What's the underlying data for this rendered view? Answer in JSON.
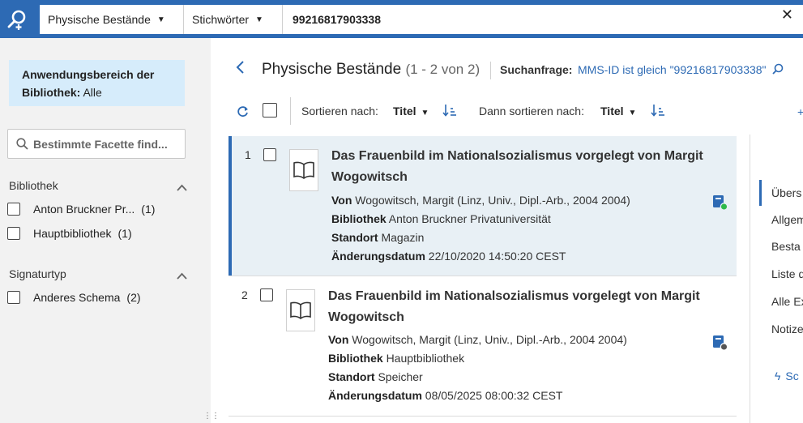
{
  "topbar": {
    "search_scope": "Physische Bestände",
    "search_field": "Stichwörter",
    "search_value": "99216817903338",
    "close_label": "✕"
  },
  "sidebar": {
    "scope_title": "Anwendungsbereich der Bibliothek:",
    "scope_value": "Alle",
    "facet_search_placeholder": "Bestimmte Facette find...",
    "facet_groups": [
      {
        "title": "Bibliothek",
        "items": [
          {
            "label": "Anton Bruckner Pr...",
            "count": "(1)"
          },
          {
            "label": "Hauptbibliothek",
            "count": "(1)"
          }
        ]
      },
      {
        "title": "Signaturtyp",
        "items": [
          {
            "label": "Anderes Schema",
            "count": "(2)"
          }
        ]
      }
    ]
  },
  "header": {
    "title": "Physische Bestände",
    "count": "(1 - 2 von 2)",
    "query_label": "Suchanfrage:",
    "query_value": "MMS-ID ist gleich \"99216817903338\""
  },
  "toolbar": {
    "sort_label": "Sortieren nach:",
    "sort_value": "Titel",
    "then_sort_label": "Dann sortieren nach:",
    "then_sort_value": "Titel"
  },
  "results": [
    {
      "num": "1",
      "title": "Das Frauenbild im Nationalsozialismus vorgelegt von Margit Wogowitsch",
      "von_label": "Von",
      "von": "Wogowitsch, Margit (Linz, Univ., Dipl.-Arb., 2004 2004)",
      "bibliothek_label": "Bibliothek",
      "bibliothek": "Anton Bruckner Privatuniversität",
      "standort_label": "Standort",
      "standort": "Magazin",
      "datum_label": "Änderungsdatum",
      "datum": "22/10/2020 14:50:20 CEST",
      "status_color": "#2db84a"
    },
    {
      "num": "2",
      "title": "Das Frauenbild im Nationalsozialismus vorgelegt von Margit Wogowitsch",
      "von_label": "Von",
      "von": "Wogowitsch, Margit (Linz, Univ., Dipl.-Arb., 2004 2004)",
      "bibliothek_label": "Bibliothek",
      "bibliothek": "Hauptbibliothek",
      "standort_label": "Standort",
      "standort": "Speicher",
      "datum_label": "Änderungsdatum",
      "datum": "08/05/2025 08:00:32 CEST",
      "status_color": "#555555"
    }
  ],
  "right_panel": {
    "items": [
      "Übers",
      "Allgem",
      "Besta",
      "Liste d",
      "Alle Ex",
      "Notize"
    ],
    "action": "Sc"
  },
  "colors": {
    "accent": "#2d6ab4",
    "scope_bg": "#d6ecfb",
    "selected_bg": "#e8f0f5"
  }
}
